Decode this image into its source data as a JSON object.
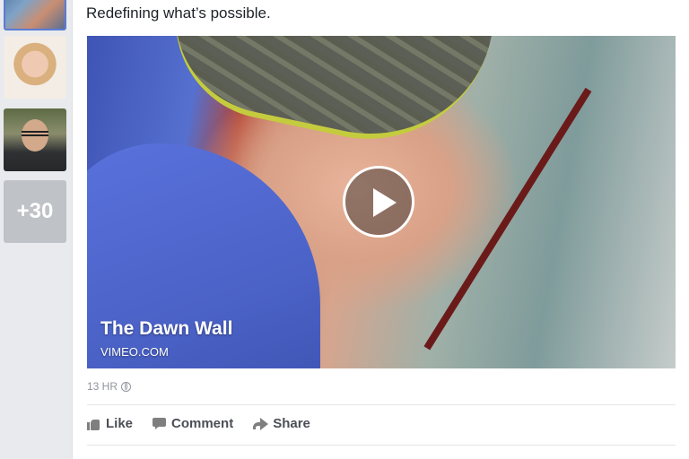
{
  "sidebar": {
    "more_count": "+30"
  },
  "post": {
    "text": "Redefining what’s possible.",
    "video": {
      "title": "The Dawn Wall",
      "source": "VIMEO.COM"
    },
    "timestamp": "13 HR",
    "privacy_icon": "globe-icon"
  },
  "actions": {
    "like": "Like",
    "comment": "Comment",
    "share": "Share"
  },
  "colors": {
    "accent": "#5b7bd5",
    "text": "#1d2129",
    "muted": "#90949c"
  }
}
